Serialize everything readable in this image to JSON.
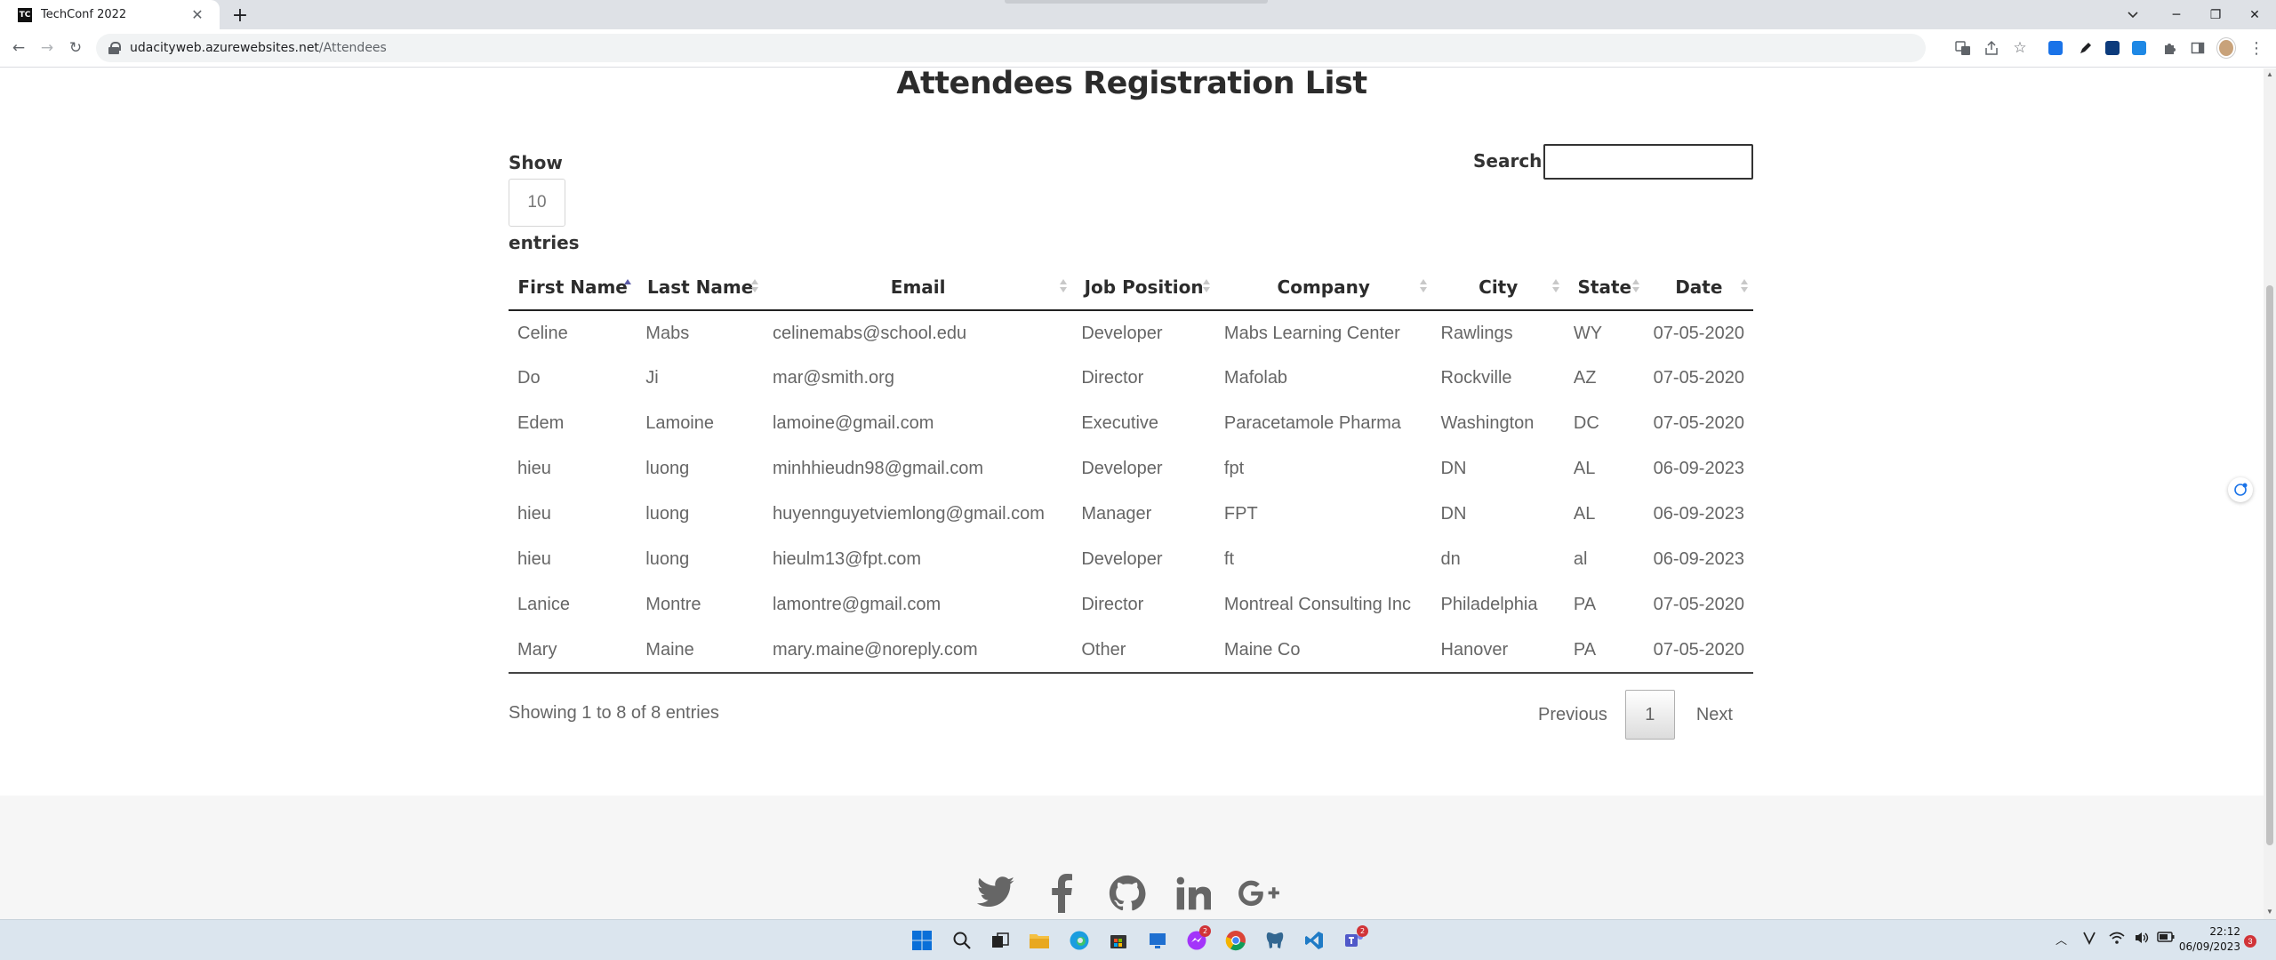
{
  "browser": {
    "tab_title": "TechConf 2022",
    "tab_favicon": "TC",
    "url_host": "udacityweb.azurewebsites.net",
    "url_path": "/Attendees"
  },
  "page": {
    "heading": "Attendees Registration List",
    "show_label": "Show",
    "page_length": "10",
    "entries_label": "entries",
    "search_label": "Search:",
    "search_value": ""
  },
  "table": {
    "columns": [
      "First Name",
      "Last Name",
      "Email",
      "Job Position",
      "Company",
      "City",
      "State",
      "Date"
    ],
    "sorted_column": "First Name",
    "rows": [
      [
        "Celine",
        "Mabs",
        "celinemabs@school.edu",
        "Developer",
        "Mabs Learning Center",
        "Rawlings",
        "WY",
        "07-05-2020"
      ],
      [
        "Do",
        "Ji",
        "mar@smith.org",
        "Director",
        "Mafolab",
        "Rockville",
        "AZ",
        "07-05-2020"
      ],
      [
        "Edem",
        "Lamoine",
        "lamoine@gmail.com",
        "Executive",
        "Paracetamole Pharma",
        "Washington",
        "DC",
        "07-05-2020"
      ],
      [
        "hieu",
        "luong",
        "minhhieudn98@gmail.com",
        "Developer",
        "fpt",
        "DN",
        "AL",
        "06-09-2023"
      ],
      [
        "hieu",
        "luong",
        "huyennguyetviemlong@gmail.com",
        "Manager",
        "FPT",
        "DN",
        "AL",
        "06-09-2023"
      ],
      [
        "hieu",
        "luong",
        "hieulm13@fpt.com",
        "Developer",
        "ft",
        "dn",
        "al",
        "06-09-2023"
      ],
      [
        "Lanice",
        "Montre",
        "lamontre@gmail.com",
        "Director",
        "Montreal Consulting Inc",
        "Philadelphia",
        "PA",
        "07-05-2020"
      ],
      [
        "Mary",
        "Maine",
        "mary.maine@noreply.com",
        "Other",
        "Maine Co",
        "Hanover",
        "PA",
        "07-05-2020"
      ]
    ]
  },
  "pagination": {
    "info": "Showing 1 to 8 of 8 entries",
    "previous": "Previous",
    "current_page": "1",
    "next": "Next"
  },
  "footer": {
    "social_icons": [
      "twitter-icon",
      "facebook-icon",
      "github-icon",
      "linkedin-icon",
      "google-plus-icon"
    ]
  },
  "taskbar": {
    "time": "22:12",
    "date": "06/09/2023",
    "notification_count": "3",
    "messenger_badge": "2",
    "teams_badge": "2"
  },
  "colors": {
    "accent_sort": "#5b5ba8",
    "footer_bg": "#f6f6f6",
    "text_muted": "#666666"
  }
}
